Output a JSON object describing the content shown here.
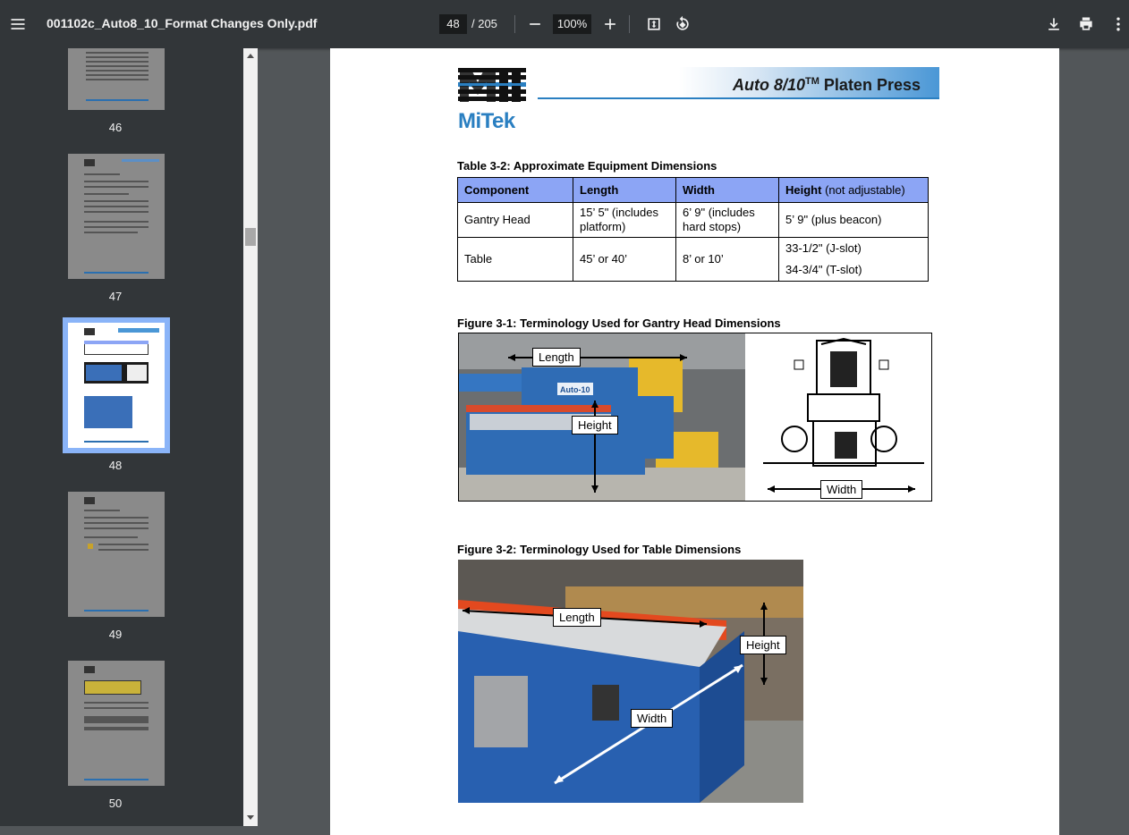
{
  "toolbar": {
    "title": "001102c_Auto8_10_Format Changes Only.pdf",
    "page_current": "48",
    "page_total": "/ 205",
    "zoom": "100%"
  },
  "sidebar": {
    "thumbnails": [
      {
        "label": "46"
      },
      {
        "label": "47"
      },
      {
        "label": "48"
      },
      {
        "label": "49"
      },
      {
        "label": "50"
      }
    ]
  },
  "document": {
    "logo_text": "MiTek",
    "header_title_italic": "Auto 8/10",
    "header_tm": "TM",
    "header_title_rest": " Platen Press",
    "table_caption": "Table 3-2: Approximate Equipment Dimensions",
    "table": {
      "headers": [
        "Component",
        "Length",
        "Width",
        "Height"
      ],
      "height_note": " (not adjustable)",
      "rows": [
        [
          "Gantry Head",
          "15’ 5\" (includes platform)",
          "6’ 9\" (includes hard stops)",
          "5’ 9\" (plus beacon)"
        ],
        [
          "Table",
          "45’ or 40’",
          "8’ or 10’",
          "33-1/2\" (J-slot)"
        ]
      ],
      "table_height_extra": "34-3/4\" (T-slot)"
    },
    "figure1_caption": "Figure 3-1: Terminology Used for Gantry Head Dimensions",
    "figure1_labels": {
      "length": "Length",
      "height": "Height",
      "width": "Width",
      "machine_label": "Auto-10"
    },
    "figure2_caption": "Figure 3-2: Terminology Used for Table Dimensions",
    "figure2_labels": {
      "length": "Length",
      "height": "Height",
      "width": "Width"
    }
  }
}
